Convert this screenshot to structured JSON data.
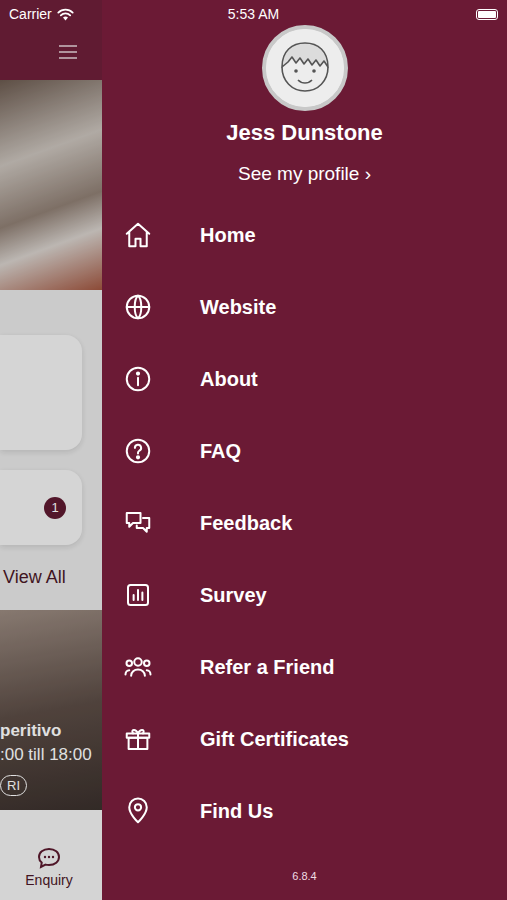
{
  "status_bar": {
    "carrier": "Carrier",
    "time": "5:53 AM",
    "battery_level": 1
  },
  "background": {
    "card_badge": "1",
    "link": "View All",
    "promo": {
      "title": "peritivo",
      "hours": ":00 till 18:00",
      "tag": "RI"
    },
    "tab_bar": [
      {
        "label": "Enquiry"
      }
    ]
  },
  "drawer": {
    "user": {
      "name": "Jess Dunstone",
      "profile_link": "See my profile ›"
    },
    "items": [
      {
        "label": "Home"
      },
      {
        "label": "Website"
      },
      {
        "label": "About"
      },
      {
        "label": "FAQ"
      },
      {
        "label": "Feedback"
      },
      {
        "label": "Survey"
      },
      {
        "label": "Refer a Friend"
      },
      {
        "label": "Gift Certificates"
      },
      {
        "label": "Find Us"
      }
    ],
    "version": "6.8.4"
  }
}
